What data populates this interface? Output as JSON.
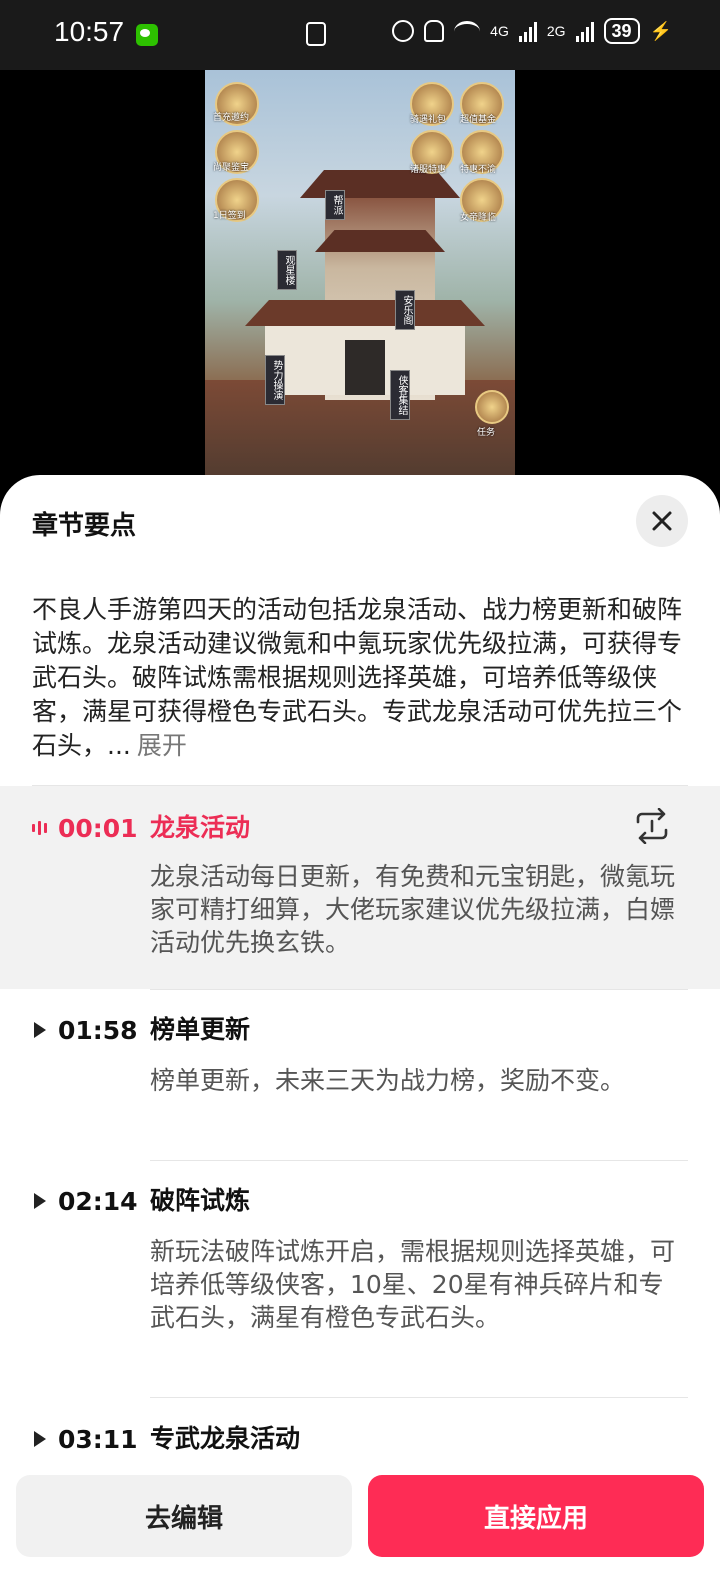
{
  "status_bar": {
    "time": "10:57",
    "network_4g": "4G",
    "network_2g": "2G",
    "battery": "39"
  },
  "video": {
    "game_labels": [
      "首充邀约",
      "骑遇礼包",
      "超值基金",
      "尚聚鉴宝",
      "诸服特惠",
      "特惠不渝",
      "1日签到",
      "女帝降临",
      "帮派",
      "观星楼",
      "安乐阁",
      "势力操演",
      "侠客集结",
      "任务"
    ]
  },
  "sheet": {
    "title": "章节要点",
    "summary": "不良人手游第四天的活动包括龙泉活动、战力榜更新和破阵试炼。龙泉活动建议微氪和中氪玩家优先级拉满，可获得专武石头。破阵试炼需根据规则选择英雄，可培养低等级侠客，满星可获得橙色专武石头。专武龙泉活动可优先拉三个石头，...",
    "expand_label": "展开",
    "chapters": [
      {
        "time": "00:01",
        "title": "龙泉活动",
        "desc": "龙泉活动每日更新，有免费和元宝钥匙，微氪玩家可精打细算，大佬玩家建议优先级拉满，白嫖活动优先换玄铁。"
      },
      {
        "time": "01:58",
        "title": "榜单更新",
        "desc": "榜单更新，未来三天为战力榜，奖励不变。"
      },
      {
        "time": "02:14",
        "title": "破阵试炼",
        "desc": "新玩法破阵试炼开启，需根据规则选择英雄，可培养低等级侠客，10星、20星有神兵碎片和专武石头，满星有橙色专武石头。"
      },
      {
        "time": "03:11",
        "title": "专武龙泉活动",
        "desc": ""
      }
    ],
    "edit_button": "去编辑",
    "apply_button": "直接应用"
  },
  "colors": {
    "accent": "#fe2c55",
    "active_text": "#ec2d55",
    "active_bg": "#f2f2f2"
  }
}
